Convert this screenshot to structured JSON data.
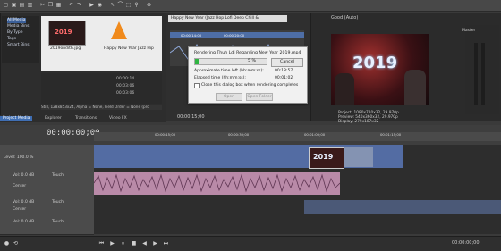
{
  "toolbar": {
    "icons": [
      "new-icon",
      "open-icon",
      "save-icon",
      "properties-icon",
      "cut-icon",
      "copy-icon",
      "paste-icon",
      "undo-icon",
      "redo-icon",
      "play-icon",
      "render-icon",
      "cursor-icon",
      "envelope-icon",
      "selection-icon",
      "zoom-icon",
      "snap-icon"
    ]
  },
  "explorer": {
    "tree": [
      {
        "label": "All Media",
        "selected": true
      },
      {
        "label": "Media Bins",
        "selected": false
      },
      {
        "label": "By Type",
        "selected": false
      },
      {
        "label": "Tags",
        "selected": false
      },
      {
        "label": "Smart Bins",
        "selected": false
      }
    ],
    "thumbs": [
      {
        "label": "2019ondith.jpg"
      },
      {
        "label": "Happy New Year Jazz Hip-Lofi Deep Chill"
      }
    ],
    "timecodes": [
      "00:00:14",
      "00:03:06",
      "00:03:06"
    ],
    "status": "Still, 128x853x24, Alpha = None, Field Order = None (pro"
  },
  "tabs": {
    "items": [
      "Project Media",
      "Explorer",
      "Transitions",
      "Video FX"
    ],
    "active": 0
  },
  "trimmer": {
    "title": "Happy New Year (Jazz Hop Lofi Deep Chill &",
    "markers": [
      "00:00:14:00",
      "00:00:20:00",
      "00:00:42:00"
    ],
    "time": "00:00:15;00"
  },
  "dialog": {
    "progress_text": "Rendering Thuh Ldi Regarding New Year 2019.mp4",
    "percent": "5 %",
    "progress": 0.05,
    "cancel": "Cancel",
    "remaining_label": "Approximate time left (hh:mm:ss):",
    "remaining": "00:18:57",
    "elapsed_label": "Elapsed time (hh:mm:ss):",
    "elapsed": "00:01:02",
    "close_label": "Close this dialog box when rendering completes",
    "open_label": "Open",
    "open_folder_label": "Open Folder"
  },
  "preview": {
    "quality": "Good (Auto)",
    "master": "Master",
    "video_text": "2019",
    "project_info": "Project: 1080x720x32, 29.970p\nPreview: 540x360x32, 29.970p\nDisplay: 279x187x32"
  },
  "timeline": {
    "time": "00:00:00;00",
    "ticks": [
      "00:00:15;00",
      "00:00:30;00",
      "00:01:00;00",
      "00:01:15;00"
    ],
    "tracks": [
      {
        "label": "Level: 100.0 %",
        "type": "video"
      },
      {
        "label": "Vol: 0.0 dB",
        "type": "audio",
        "touch": "Touch",
        "pan": "Center"
      },
      {
        "label": "Vol: 0.0 dB",
        "type": "audio",
        "touch": "Touch",
        "pan": "Center"
      },
      {
        "label": "Vol: 0.0 dB",
        "type": "audio",
        "touch": "Touch",
        "pan": "Center"
      }
    ]
  },
  "transport": {
    "icons": [
      "record-icon",
      "loop-icon",
      "play-start-icon",
      "play-icon",
      "pause-icon",
      "stop-icon",
      "prev-frame-icon",
      "next-frame-icon",
      "end-icon"
    ],
    "right": "00:00:00;00"
  },
  "colors": {
    "accent": "#3f6eb3",
    "progress_fill": "#2fb541",
    "audio_clip": "#b98aa8",
    "video_clip": "#6e8fc8"
  }
}
